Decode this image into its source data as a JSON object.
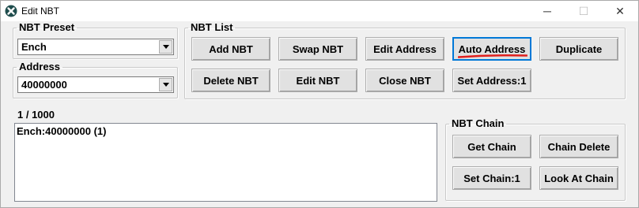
{
  "window": {
    "title": "Edit NBT",
    "icon": "x-app-icon",
    "controls": {
      "minimize": "─",
      "maximize": "☐",
      "close": "✕"
    }
  },
  "nbt_preset": {
    "label": "NBT Preset",
    "value": "Ench"
  },
  "address": {
    "label": "Address",
    "value": "40000000"
  },
  "nbt_list": {
    "label": "NBT List",
    "buttons": {
      "add": "Add NBT",
      "swap": "Swap NBT",
      "edit_address": "Edit Address",
      "auto_address": "Auto Address",
      "duplicate": "Duplicate",
      "delete": "Delete NBT",
      "edit": "Edit NBT",
      "close": "Close NBT",
      "set_address": "Set Address:1"
    }
  },
  "list": {
    "counter": "1 / 1000",
    "items": [
      "Ench:40000000 (1)"
    ]
  },
  "nbt_chain": {
    "label": "NBT Chain",
    "buttons": {
      "get": "Get Chain",
      "delete": "Chain Delete",
      "set": "Set Chain:1",
      "look": "Look At Chain"
    }
  },
  "colors": {
    "window_bg": "#f0f0f0",
    "button_face": "#e1e1e1",
    "focus_border": "#0078d7",
    "annotation_red": "#e0201e"
  }
}
